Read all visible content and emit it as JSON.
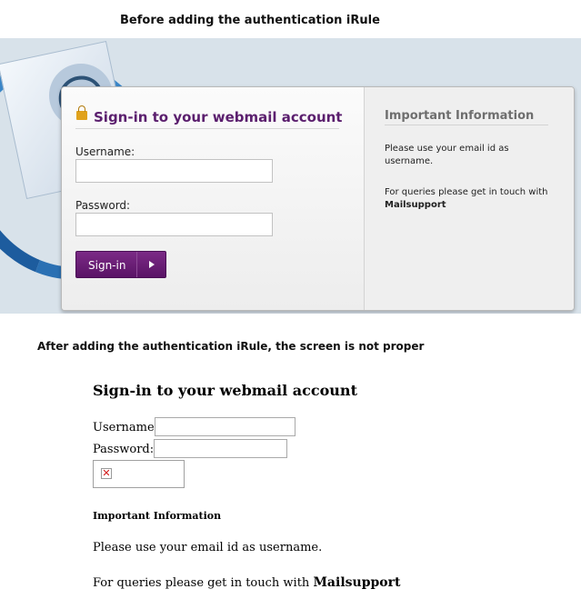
{
  "captions": {
    "before": "Before adding the authentication iRule",
    "after": "After adding the authentication iRule, the screen is not proper"
  },
  "login_before": {
    "title": "Sign-in to your webmail account",
    "username_label": "Username:",
    "password_label": "Password:",
    "username_value": "",
    "password_value": "",
    "signin_button": "Sign-in",
    "info_title": "Important Information",
    "info_line1": "Please use your email id as username.",
    "info_line2": "For queries please get in touch with",
    "info_contact": "Mailsupport",
    "colors": {
      "accent": "#5b1f6e",
      "button": "#6a1f76"
    },
    "logo_glyph": "@"
  },
  "login_after": {
    "title": "Sign-in to your webmail account",
    "username_label": "Username:",
    "password_label": "Password:",
    "info_title": "Important Information",
    "info_line1": "Please use your email id as username.",
    "info_line2": "For queries please get in touch with",
    "info_contact": "Mailsupport",
    "broken_image_glyph": "✕"
  }
}
